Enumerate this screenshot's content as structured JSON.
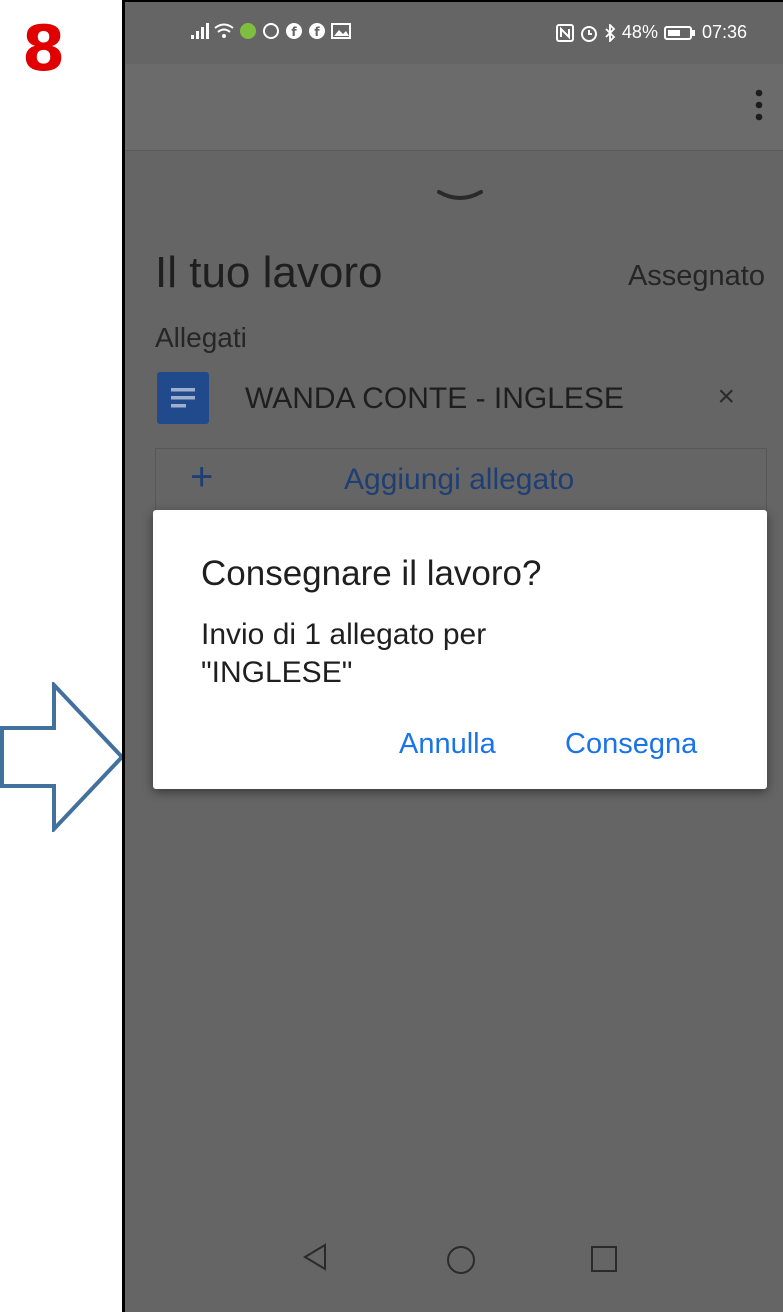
{
  "annotation": {
    "step_number": "8",
    "step_color": "#e00000",
    "arrow_color": "#41719c"
  },
  "status_bar": {
    "battery": "48%",
    "time": "07:36"
  },
  "classwork": {
    "title": "Il tuo lavoro",
    "status": "Assegnato",
    "attachments_label": "Allegati",
    "attachment_name": "WANDA CONTE - INGLESE",
    "add_attachment_label": "Aggiungi allegato"
  },
  "dialog": {
    "title": "Consegnare il lavoro?",
    "message_line1": "Invio di 1 allegato per",
    "message_line2": "\"INGLESE\"",
    "cancel_label": "Annulla",
    "submit_label": "Consegna",
    "accent_color": "#1a73e8"
  },
  "nav_bar": {
    "icons": [
      "back-icon",
      "home-icon",
      "recents-icon"
    ]
  }
}
